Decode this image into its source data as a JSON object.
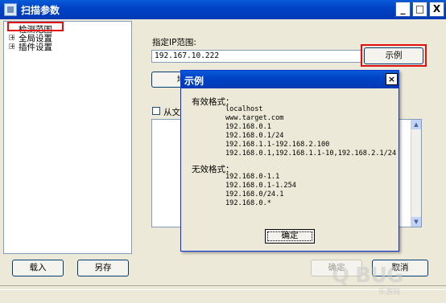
{
  "window": {
    "title": "扫描参数",
    "min_label": "_",
    "max_label": "□",
    "close_label": "X"
  },
  "tree": {
    "items": [
      {
        "label": "检测范围",
        "expandable": false,
        "selected": true
      },
      {
        "label": "全局设置",
        "expandable": true
      },
      {
        "label": "插件设置",
        "expandable": true
      }
    ]
  },
  "range": {
    "ip_label": "指定IP范围:",
    "ip_value": "192.167.10.222",
    "example_button": "示例",
    "address_button": "地",
    "from_file_label": "从文"
  },
  "footer": {
    "load_button": "载入",
    "save_as_button": "另存",
    "ok_button": "确定",
    "cancel_button": "取消"
  },
  "dialog": {
    "title": "示例",
    "close_label": "×",
    "valid_heading": "有效格式：",
    "valid_examples": [
      "localhost",
      "www.target.com",
      "192.168.0.1",
      "192.168.0.1/24",
      "192.168.1.1-192.168.2.100",
      "192.168.0.1,192.168.1.1-10,192.168.2.1/24"
    ],
    "invalid_heading": "无效格式：",
    "invalid_examples": [
      "192.168.0-1.1",
      "192.168.0.1-1.254",
      "192.168.0/24.1",
      "192.168.0.*"
    ],
    "ok_button": "确定"
  },
  "watermark": {
    "text": "Q BUG",
    "subtext": "乐游网"
  },
  "colors": {
    "titlebar": "#0043C6",
    "highlight_red": "#E01010",
    "window_bg": "#ECE9D8"
  }
}
